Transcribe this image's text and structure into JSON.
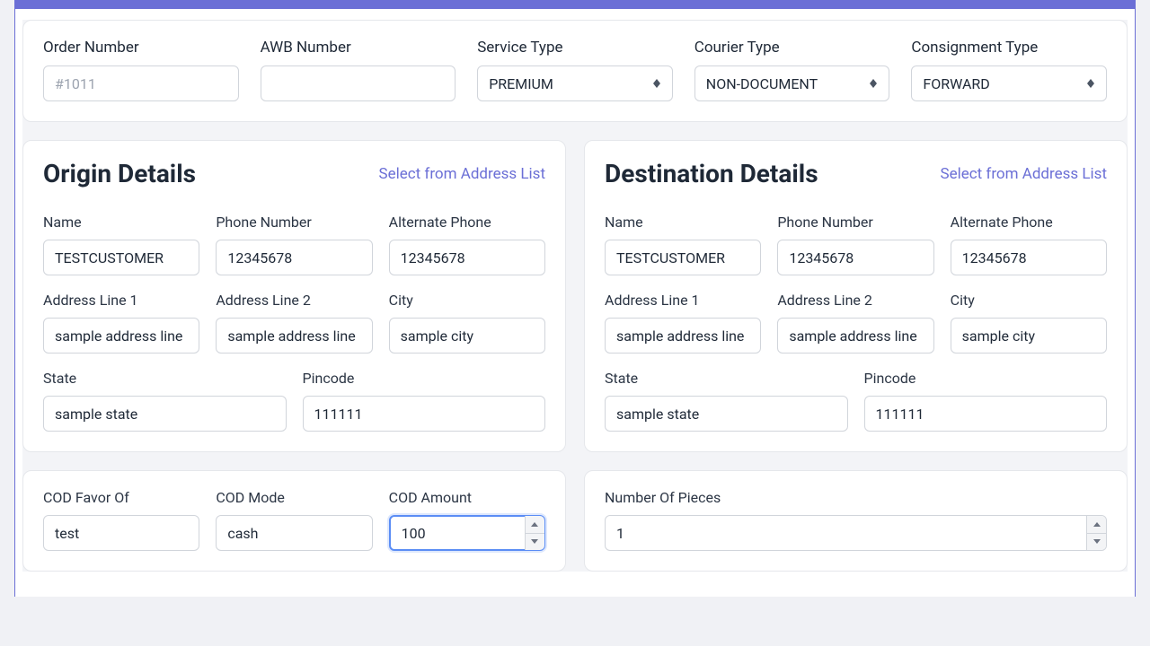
{
  "top": {
    "order_number": {
      "label": "Order Number",
      "placeholder": "#1011",
      "value": ""
    },
    "awb_number": {
      "label": "AWB Number",
      "value": ""
    },
    "service_type": {
      "label": "Service Type",
      "value": "PREMIUM"
    },
    "courier_type": {
      "label": "Courier Type",
      "value": "NON-DOCUMENT"
    },
    "consignment_type": {
      "label": "Consignment Type",
      "value": "FORWARD"
    }
  },
  "origin": {
    "title": "Origin Details",
    "link": "Select from Address List",
    "name": {
      "label": "Name",
      "value": "TESTCUSTOMER"
    },
    "phone": {
      "label": "Phone Number",
      "value": "12345678"
    },
    "alt_phone": {
      "label": "Alternate Phone",
      "value": "12345678"
    },
    "addr1": {
      "label": "Address Line 1",
      "value": "sample address line"
    },
    "addr2": {
      "label": "Address Line 2",
      "value": "sample address line"
    },
    "city": {
      "label": "City",
      "value": "sample city"
    },
    "state": {
      "label": "State",
      "value": "sample state"
    },
    "pincode": {
      "label": "Pincode",
      "value": "111111"
    }
  },
  "destination": {
    "title": "Destination Details",
    "link": "Select from Address List",
    "name": {
      "label": "Name",
      "value": "TESTCUSTOMER"
    },
    "phone": {
      "label": "Phone Number",
      "value": "12345678"
    },
    "alt_phone": {
      "label": "Alternate Phone",
      "value": "12345678"
    },
    "addr1": {
      "label": "Address Line 1",
      "value": "sample address line"
    },
    "addr2": {
      "label": "Address Line 2",
      "value": "sample address line"
    },
    "city": {
      "label": "City",
      "value": "sample city"
    },
    "state": {
      "label": "State",
      "value": "sample state"
    },
    "pincode": {
      "label": "Pincode",
      "value": "111111"
    }
  },
  "cod": {
    "favor": {
      "label": "COD Favor Of",
      "value": "test"
    },
    "mode": {
      "label": "COD Mode",
      "value": "cash"
    },
    "amount": {
      "label": "COD Amount",
      "value": "100"
    }
  },
  "pieces": {
    "count": {
      "label": "Number Of Pieces",
      "value": "1"
    }
  }
}
